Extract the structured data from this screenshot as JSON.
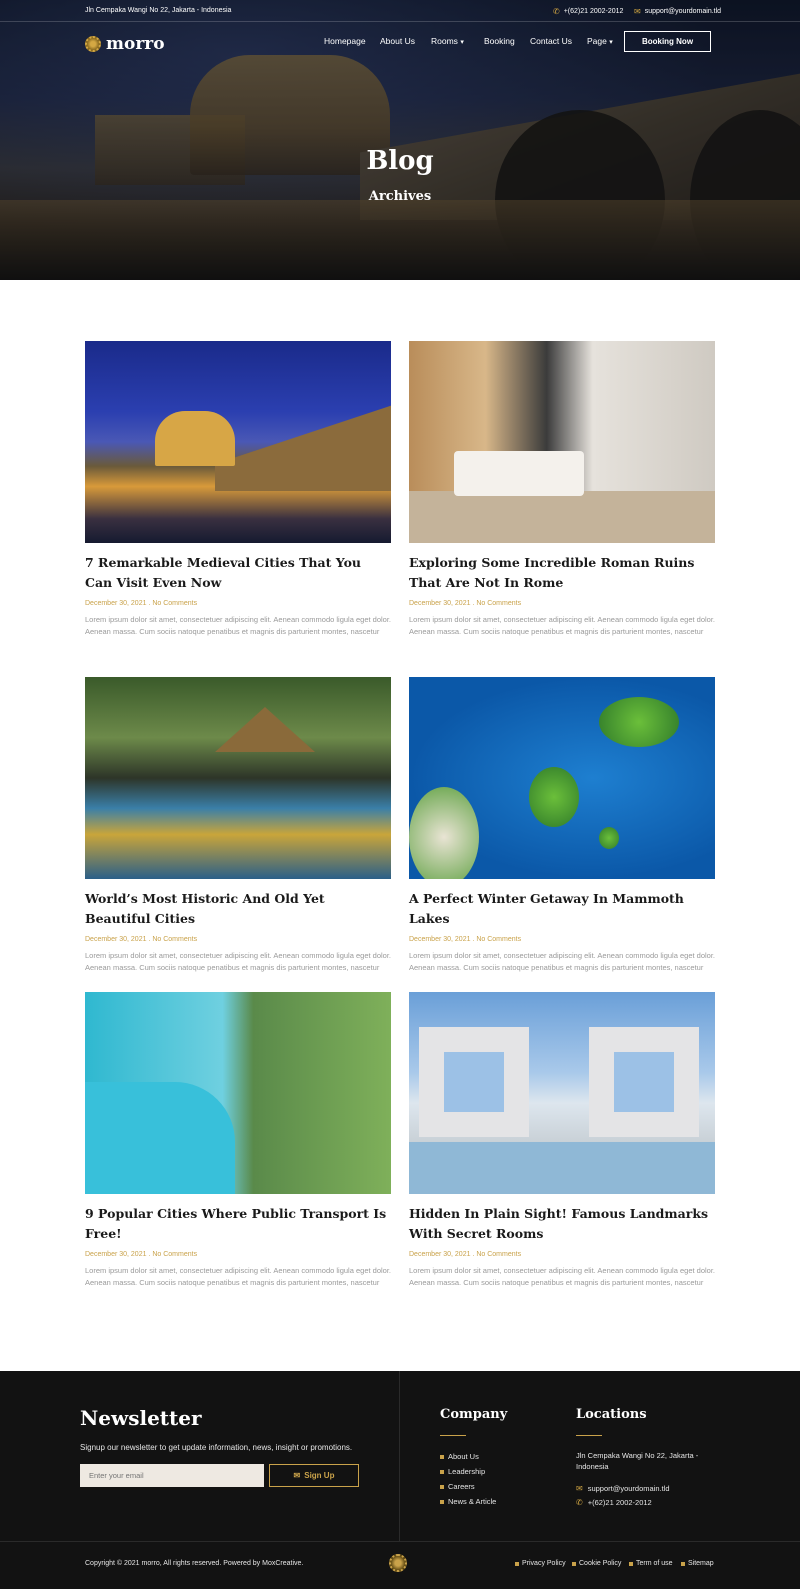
{
  "topbar": {
    "address": "Jln Cempaka Wangi No 22, Jakarta - Indonesia",
    "phone": "+(62)21 2002-2012",
    "email": "support@yourdomain.tld"
  },
  "brand": {
    "name": "morro",
    "accent": "#c9a24a"
  },
  "nav": {
    "items": [
      "Homepage",
      "About Us",
      "Rooms",
      "Booking",
      "Contact Us",
      "Page"
    ],
    "cta": "Booking Now"
  },
  "hero": {
    "title": "Blog",
    "subtitle": "Archives"
  },
  "posts": [
    {
      "title": "7 Remarkable Medieval Cities That You Can Visit Even Now",
      "date": "December 30, 2021",
      "comments": "No Comments",
      "excerpt": "Lorem ipsum dolor sit amet, consectetuer adipiscing elit. Aenean commodo ligula eget dolor. Aenean massa. Cum sociis natoque penatibus et magnis dis parturient montes, nascetur"
    },
    {
      "title": "Exploring Some Incredible Roman Ruins That Are Not In Rome",
      "date": "December 30, 2021",
      "comments": "No Comments",
      "excerpt": "Lorem ipsum dolor sit amet, consectetuer adipiscing elit. Aenean commodo ligula eget dolor. Aenean massa. Cum sociis natoque penatibus et magnis dis parturient montes, nascetur"
    },
    {
      "title": "World’s Most Historic And Old Yet Beautiful Cities",
      "date": "December 30, 2021",
      "comments": "No Comments",
      "excerpt": "Lorem ipsum dolor sit amet, consectetuer adipiscing elit. Aenean commodo ligula eget dolor. Aenean massa. Cum sociis natoque penatibus et magnis dis parturient montes, nascetur"
    },
    {
      "title": "A Perfect Winter Getaway In Mammoth Lakes",
      "date": "December 30, 2021",
      "comments": "No Comments",
      "excerpt": "Lorem ipsum dolor sit amet, consectetuer adipiscing elit. Aenean commodo ligula eget dolor. Aenean massa. Cum sociis natoque penatibus et magnis dis parturient montes, nascetur"
    },
    {
      "title": "9 Popular Cities Where Public Transport Is Free!",
      "date": "December 30, 2021",
      "comments": "No Comments",
      "excerpt": "Lorem ipsum dolor sit amet, consectetuer adipiscing elit. Aenean commodo ligula eget dolor. Aenean massa. Cum sociis natoque penatibus et magnis dis parturient montes, nascetur"
    },
    {
      "title": "Hidden In Plain Sight! Famous Landmarks With Secret Rooms",
      "date": "December 30, 2021",
      "comments": "No Comments",
      "excerpt": "Lorem ipsum dolor sit amet, consectetuer adipiscing elit. Aenean commodo ligula eget dolor. Aenean massa. Cum sociis natoque penatibus et magnis dis parturient montes, nascetur"
    }
  ],
  "newsletter": {
    "title": "Newsletter",
    "text": "Signup our newsletter to get update information, news, insight or promotions.",
    "placeholder": "Enter your email",
    "button": "Sign Up"
  },
  "company": {
    "title": "Company",
    "links": [
      "About Us",
      "Leadership",
      "Careers",
      "News & Article"
    ]
  },
  "locations": {
    "title": "Locations",
    "address": "Jln Cempaka Wangi No 22, Jakarta - Indonesia",
    "email": "support@yourdomain.tld",
    "phone": "+(62)21 2002-2012"
  },
  "bottom": {
    "copyright": "Copyright © 2021 morro, All rights reserved. Powered by MoxCreative.",
    "links": [
      "Privacy Policy",
      "Cookie Policy",
      "Term of use",
      "Sitemap"
    ]
  }
}
